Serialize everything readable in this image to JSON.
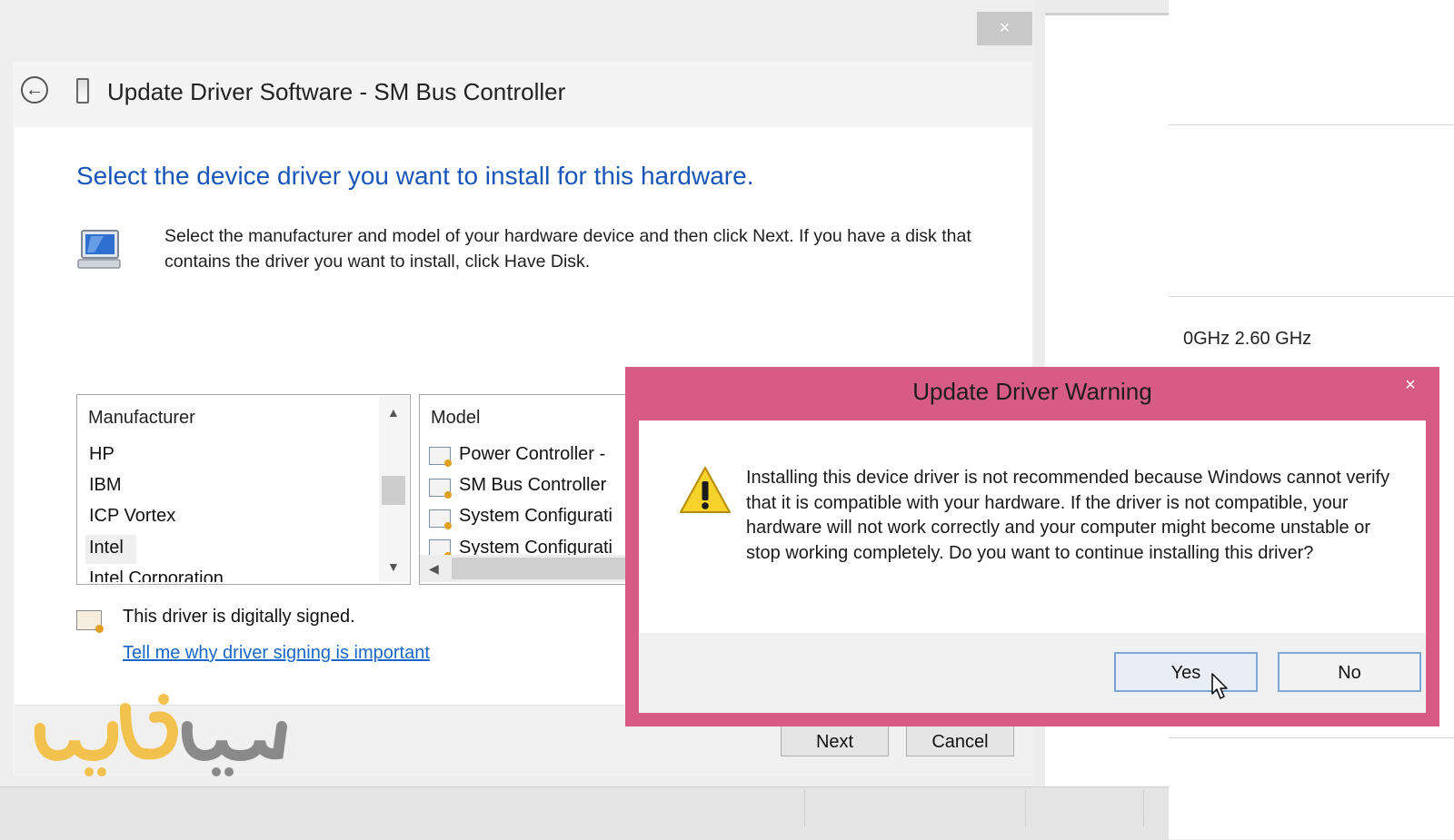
{
  "background": {
    "cpu_speed_text": "0GHz   2.60 GHz"
  },
  "wizard": {
    "title": "Update Driver Software - SM Bus Controller",
    "heading": "Select the device driver you want to install for this hardware.",
    "description": "Select the manufacturer and model of your hardware device and then click Next. If you have a disk that contains the driver you want to install, click Have Disk.",
    "manufacturer_header": "Manufacturer",
    "manufacturers": [
      "HP",
      "IBM",
      "ICP Vortex",
      "Intel",
      "Intel Corporation"
    ],
    "selected_manufacturer": "Intel",
    "model_header": "Model",
    "models": [
      "Power Controller -",
      "SM Bus Controller",
      "System Configurati",
      "System Configurati"
    ],
    "signed_text": "This driver is digitally signed.",
    "signing_link": "Tell me why driver signing is important",
    "next_label": "Next",
    "cancel_label": "Cancel",
    "close_glyph": "×",
    "back_glyph": "←"
  },
  "warning_dialog": {
    "title": "Update Driver Warning",
    "message": "Installing this device driver is not recommended because Windows cannot verify that it is compatible with your hardware.  If the driver is not compatible, your hardware will not work correctly and your computer might become unstable or stop working completely.  Do you want to continue installing this driver?",
    "yes_label": "Yes",
    "no_label": "No",
    "close_glyph": "×",
    "accent_color": "#d65c86"
  },
  "watermark": {
    "text": "سيتيب"
  },
  "icons": [
    "back-arrow-icon",
    "device-icon",
    "monitor-icon",
    "certificate-icon",
    "driver-model-icon",
    "warning-icon",
    "mouse-cursor-icon"
  ]
}
